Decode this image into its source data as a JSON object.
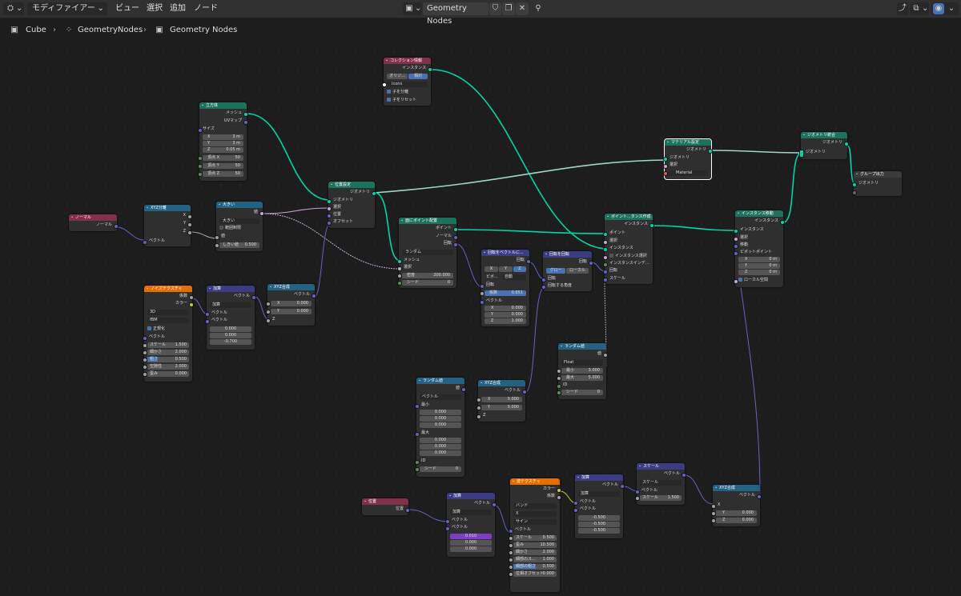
{
  "header": {
    "editor_type_icon": "node-editor-icon",
    "mode_label": "モディファイアー",
    "menus": [
      "ビュー",
      "選択",
      "追加",
      "ノード"
    ],
    "nodetree_name": "Geometry Nodes",
    "right_icons": [
      "pin-icon",
      "overlay-icon",
      "gizmo-icon"
    ]
  },
  "breadcrumb": [
    "Cube",
    "GeometryNodes",
    "Geometry Nodes"
  ],
  "colors": {
    "geometry": "#00d6a3",
    "vector": "#6363c7",
    "float": "#a1a1a1",
    "color": "#c7c729",
    "input_header": "#83314a",
    "geometry_header": "#1d725e",
    "converter_header": "#246283",
    "texture_header": "#e66d00",
    "vector_header": "#3c3c83",
    "node_bg": "#2f2f2f",
    "canvas": "#1d1d1d"
  },
  "nodes": {
    "collection_info": {
      "title": "コレクション情報",
      "out_instances": "インスタンス",
      "tab_original": "オリジ...",
      "tab_relative": "相対",
      "collection": "Icons",
      "sep_children": "子を分離",
      "reset_children": "子をリセット"
    },
    "cube": {
      "title": "立方体",
      "out_mesh": "メッシュ",
      "out_uv": "UVマップ",
      "size_label": "サイズ",
      "size_x": "X",
      "size_x_val": "3 m",
      "size_y": "Y",
      "size_y_val": "3 m",
      "size_z": "Z",
      "size_z_val": "0.05 m",
      "verts_x": "頂点 X",
      "verts_x_val": "50",
      "verts_y": "頂点 Y",
      "verts_y_val": "50",
      "verts_z": "頂点 Z",
      "verts_z_val": "50"
    },
    "normal": {
      "title": "ノーマル",
      "out": "ノーマル"
    },
    "separate_xyz": {
      "title": "XYZ分離",
      "x": "X",
      "y": "Y",
      "z": "Z",
      "in": "ベクトル"
    },
    "compare": {
      "title": "大きい",
      "out": "値",
      "mode": "大きい",
      "clamp": "範囲制限",
      "value": "値",
      "threshold": "しきい値",
      "threshold_val": "0.500"
    },
    "set_position": {
      "title": "位置設定",
      "out": "ジオメトリ",
      "geo": "ジオメトリ",
      "select": "選択",
      "position": "位置",
      "offset": "オフセット"
    },
    "distribute": {
      "title": "面にポイント配置",
      "out_points": "ポイント",
      "out_normal": "ノーマル",
      "out_rot": "回転",
      "mode": "ランダム",
      "mesh": "メッシュ",
      "select": "選択",
      "density": "密度",
      "density_val": "200.000",
      "seed": "シード",
      "seed_val": "0"
    },
    "align_euler": {
      "title": "回転をベクトルに...",
      "out": "回転",
      "x": "X",
      "y": "Y",
      "z": "Z",
      "pivot": "ピボ...",
      "pivot_val": "自動",
      "rot": "回転",
      "factor": "係数",
      "factor_val": "0.651",
      "vector": "ベクトル",
      "vx": "X",
      "vx_val": "0.000",
      "vy": "Y",
      "vy_val": "0.000",
      "vz": "Z",
      "vz_val": "1.000"
    },
    "rotate_euler": {
      "title": "回転を回転",
      "out": "回転",
      "global": "グロー",
      "local": "ローカル",
      "rot": "回転",
      "rotate_by": "回転する角度"
    },
    "instance_on_points": {
      "title": "ポイント...タンス作成",
      "out": "インスタンス",
      "points": "ポイント",
      "select": "選択",
      "instance": "インスタンス",
      "pick": "インスタンス選択",
      "index": "インスタンスインデ...",
      "rot": "回転",
      "scale": "スケール"
    },
    "material": {
      "title": "マテリアル設定",
      "out": "ジオメトリ",
      "geo": "ジオメトリ",
      "select": "選択",
      "mat": "Material"
    },
    "join": {
      "title": "ジオメトリ統合",
      "out": "ジオメトリ",
      "geo": "ジオメトリ"
    },
    "group_output": {
      "title": "グループ出力",
      "geo": "ジオメトリ"
    },
    "translate": {
      "title": "インスタンス移動",
      "out": "インスタンス",
      "inst": "インスタンス",
      "select": "選択",
      "trans": "移動",
      "pivot": "ピボットポイント",
      "x": "X",
      "x_val": "0 m",
      "y": "Y",
      "y_val": "0 m",
      "z": "Z",
      "z_val": "0 m",
      "local": "ローカル空間"
    },
    "noise": {
      "title": "ノイズテクスチャ",
      "fac": "係数",
      "color": "カラー",
      "dim": "3D",
      "type": "fBM",
      "normalize": "正規化",
      "vector": "ベクトル",
      "scale": "スケール",
      "scale_val": "1.500",
      "detail": "細かさ",
      "detail_val": "2.000",
      "rough": "粗さ",
      "rough_val": "0.500",
      "lac": "空隙性",
      "lac_val": "2.000",
      "distort": "歪み",
      "distort_val": "0.000"
    },
    "add1": {
      "title": "加算",
      "out": "ベクトル",
      "op": "加算",
      "v1": "ベクトル",
      "v2": "ベクトル",
      "a": "0.000",
      "b": "0.000",
      "c": "-0.700"
    },
    "combine1": {
      "title": "XYZ合成",
      "out": "ベクトル",
      "x": "X",
      "x_val": "0.000",
      "y": "Y",
      "y_val": "0.000",
      "z": "Z"
    },
    "random_float": {
      "title": "ランダム値",
      "out": "値",
      "type": "Float",
      "min": "最小",
      "min_val": "3.000",
      "max": "最大",
      "max_val": "5.000",
      "id": "ID",
      "seed": "シード",
      "seed_val": "0"
    },
    "random_vec": {
      "title": "ランダム値",
      "out": "値",
      "type": "ベクトル",
      "min": "最小",
      "max": "最大",
      "v0": "0.000",
      "id": "ID",
      "seed": "シード",
      "seed_val": "0"
    },
    "combine2": {
      "title": "XYZ合成",
      "out": "ベクトル",
      "x": "X",
      "x_val": "0.000",
      "y": "Y",
      "y_val": "0.000",
      "z": "Z"
    },
    "position": {
      "title": "位置",
      "out": "位置"
    },
    "add2": {
      "title": "加算",
      "out": "ベクトル",
      "op": "加算",
      "v1": "ベクトル",
      "v2": "ベクトル",
      "a": "0.010",
      "b": "0.000",
      "c": "0.000"
    },
    "wave": {
      "title": "波テクスチャ",
      "color": "カラー",
      "fac": "係数",
      "type": "バンド",
      "dir": "X",
      "profile": "サイン",
      "vector": "ベクトル",
      "scale": "スケール",
      "scale_val": "0.500",
      "distort": "歪み",
      "distort_val": "10.500",
      "detail": "細かさ",
      "detail_val": "2.000",
      "dscale": "細部のス...",
      "dscale_val": "1.000",
      "rough": "細部の粗さ",
      "rough_val": "0.500",
      "phase": "位相オフセット",
      "phase_val": "0.000"
    },
    "add3": {
      "title": "加算",
      "out": "ベクトル",
      "op": "加算",
      "v1": "ベクトル",
      "v2": "ベクトル",
      "a": "-0.500",
      "b": "-0.500",
      "c": "-0.500"
    },
    "scale": {
      "title": "スケール",
      "out": "ベクトル",
      "op": "スケール",
      "vector": "ベクトル",
      "scale": "スケール",
      "scale_val": "1.500"
    },
    "combine3": {
      "title": "XYZ合成",
      "out": "ベクトル",
      "x": "X",
      "y": "Y",
      "y_val": "0.000",
      "z": "Z",
      "z_val": "0.000"
    }
  }
}
